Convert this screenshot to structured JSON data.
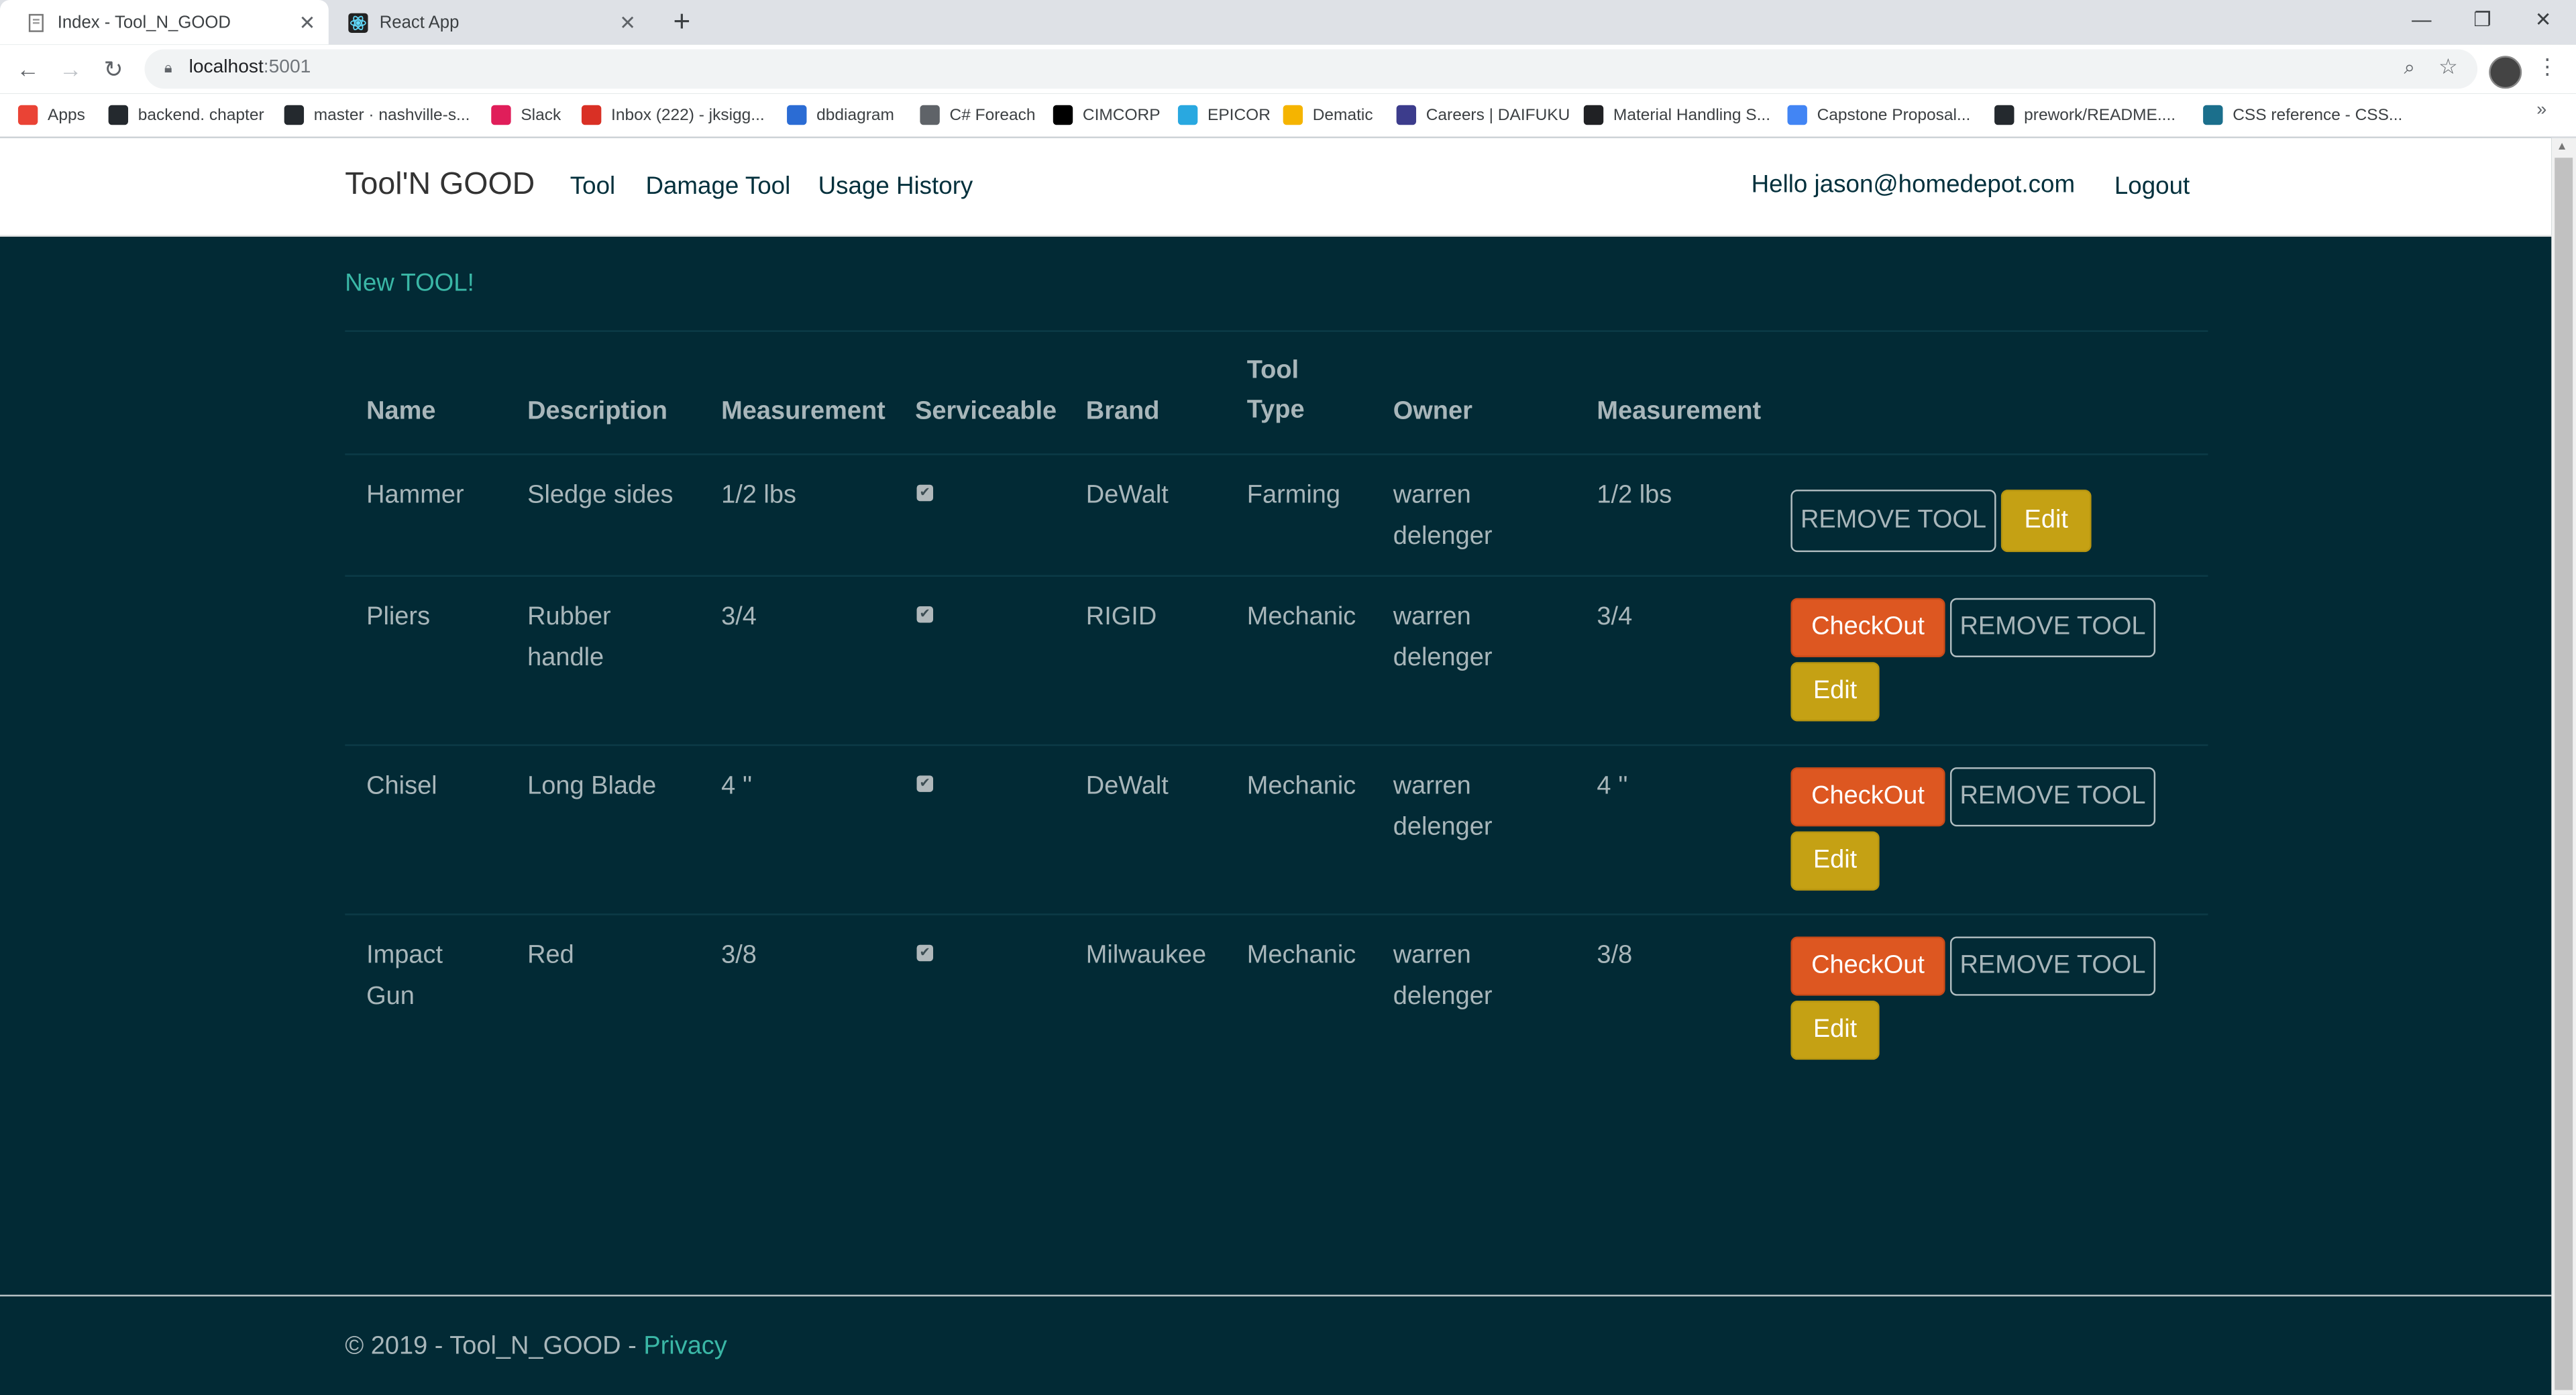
{
  "browser": {
    "tabs": [
      {
        "title": "Index - Tool_N_GOOD",
        "active": true
      },
      {
        "title": "React App",
        "active": false
      }
    ],
    "url_host": "localhost",
    "url_port": ":5001",
    "bookmarks": [
      {
        "label": "Apps",
        "icon": "apps-grid-icon",
        "color": "#ea4335"
      },
      {
        "label": "backend. chapter",
        "icon": "github-icon",
        "color": "#24292e"
      },
      {
        "label": "master · nashville-s...",
        "icon": "github-icon",
        "color": "#24292e"
      },
      {
        "label": "Slack",
        "icon": "slack-icon",
        "color": "#e01e5a"
      },
      {
        "label": "Inbox (222) - jksigg...",
        "icon": "gmail-icon",
        "color": "#d93025"
      },
      {
        "label": "dbdiagram",
        "icon": "dbdiagram-icon",
        "color": "#2b6cd4"
      },
      {
        "label": "C# Foreach",
        "icon": "globe-icon",
        "color": "#5f6368"
      },
      {
        "label": "CIMCORP",
        "icon": "cimcorp-icon",
        "color": "#000000"
      },
      {
        "label": "EPICOR",
        "icon": "epicor-icon",
        "color": "#29a8e0"
      },
      {
        "label": "Dematic",
        "icon": "dematic-icon",
        "color": "#f5b400"
      },
      {
        "label": "Careers | DAIFUKU",
        "icon": "daifuku-icon",
        "color": "#3c3c8c"
      },
      {
        "label": "Material Handling S...",
        "icon": "b-icon",
        "color": "#202124"
      },
      {
        "label": "Capstone Proposal...",
        "icon": "docs-icon",
        "color": "#4285f4"
      },
      {
        "label": "prework/README....",
        "icon": "github-icon",
        "color": "#24292e"
      },
      {
        "label": "CSS reference - CSS...",
        "icon": "mdn-icon",
        "color": "#1b6f8c"
      }
    ]
  },
  "site": {
    "brand": "Tool'N GOOD",
    "nav": [
      "Tool",
      "Damage Tool",
      "Usage History"
    ],
    "hello": "Hello jason@homedepot.com",
    "logout": "Logout",
    "new_tool": "New TOOL!"
  },
  "table": {
    "headers": [
      "Name",
      "Description",
      "Measurement",
      "Serviceable",
      "Brand",
      "Tool Type",
      "Owner",
      "Measurement"
    ],
    "header_tool_type_line1": "Tool",
    "header_tool_type_line2": "Type",
    "rows": [
      {
        "name": "Hammer",
        "description": "Sledge sides",
        "measurement": "1/2 lbs",
        "serviceable": true,
        "brand": "DeWalt",
        "tool_type": "Farming",
        "owner": "warren delenger",
        "measurement2": "1/2 lbs",
        "checkout": false
      },
      {
        "name": "Pliers",
        "description": "Rubber handle",
        "measurement": "3/4",
        "serviceable": true,
        "brand": "RIGID",
        "tool_type": "Mechanic",
        "owner": "warren delenger",
        "measurement2": "3/4",
        "checkout": true
      },
      {
        "name": "Chisel",
        "description": "Long Blade",
        "measurement": "4 ''",
        "serviceable": true,
        "brand": "DeWalt",
        "tool_type": "Mechanic",
        "owner": "warren delenger",
        "measurement2": "4 ''",
        "checkout": true
      },
      {
        "name": "Impact Gun",
        "description": "Red",
        "measurement": "3/8",
        "serviceable": true,
        "brand": "Milwaukee",
        "tool_type": "Mechanic",
        "owner": "warren delenger",
        "measurement2": "3/8",
        "checkout": true
      }
    ],
    "buttons": {
      "checkout": "CheckOut",
      "remove": "REMOVE TOOL",
      "edit": "Edit"
    }
  },
  "footer": {
    "text": "© 2019 - Tool_N_GOOD - ",
    "privacy": "Privacy"
  },
  "colors": {
    "page_bg": "#022a35",
    "accent_teal": "#3ab7a6",
    "checkout": "#dd5721",
    "edit": "#c5a114"
  }
}
